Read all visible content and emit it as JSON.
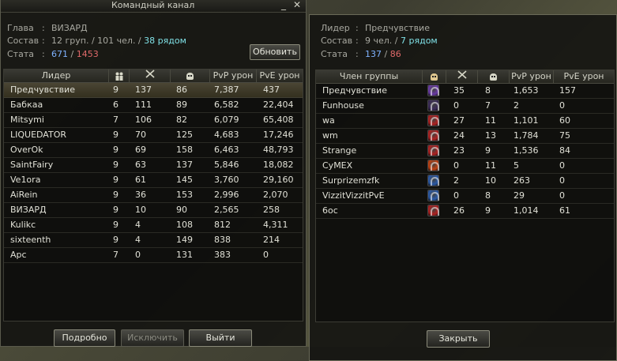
{
  "left": {
    "title": "Командный канал",
    "info": {
      "leader_label": "Глава",
      "leader_value": "ВИЗАРД",
      "composition_label": "Состав",
      "composition_groups": "12 груп. / 101 чел. /",
      "composition_nearby": "38 рядом",
      "stats_label": "Стата",
      "stats_pvp": "671",
      "stats_slash": "/",
      "stats_pve": "1453",
      "colon": ":"
    },
    "refresh_button": "Обновить",
    "columns": [
      "Лидер",
      "",
      "",
      "",
      "PvP урон",
      "PvE урон"
    ],
    "rows": [
      [
        "Предчувствие",
        "9",
        "137",
        "86",
        "7,387",
        "437"
      ],
      [
        "Бабкаа",
        "6",
        "111",
        "89",
        "6,582",
        "22,404"
      ],
      [
        "Mitsymi",
        "7",
        "106",
        "82",
        "6,079",
        "65,408"
      ],
      [
        "LIQUEDATOR",
        "9",
        "70",
        "125",
        "4,683",
        "17,246"
      ],
      [
        "OverOk",
        "9",
        "69",
        "158",
        "6,463",
        "48,793"
      ],
      [
        "SaintFairy",
        "9",
        "63",
        "137",
        "5,846",
        "18,082"
      ],
      [
        "Ve1ora",
        "9",
        "61",
        "145",
        "3,760",
        "29,160"
      ],
      [
        "AiRein",
        "9",
        "36",
        "153",
        "2,996",
        "2,070"
      ],
      [
        "ВИЗАРД",
        "9",
        "10",
        "90",
        "2,565",
        "258"
      ],
      [
        "Kulikc",
        "9",
        "4",
        "108",
        "812",
        "4,311"
      ],
      [
        "sixteenth",
        "9",
        "4",
        "149",
        "838",
        "214"
      ],
      [
        "Apc",
        "7",
        "0",
        "131",
        "383",
        "0"
      ]
    ],
    "buttons": {
      "details": "Подробно",
      "exclude": "Исключить",
      "exit": "Выйти"
    }
  },
  "right": {
    "info": {
      "leader_label": "Лидер",
      "leader_value": "Предчувствие",
      "composition_label": "Состав",
      "composition_members": "9 чел. /",
      "composition_nearby": "7 рядом",
      "stats_label": "Стата",
      "stats_pvp": "137",
      "stats_slash": "/",
      "stats_pve": "86",
      "colon": ":"
    },
    "columns": [
      "Член группы",
      "",
      "",
      "",
      "PvP урон",
      "PvE урон"
    ],
    "rows": [
      [
        "Предчувствие",
        "purple",
        "35",
        "8",
        "1,653",
        "157"
      ],
      [
        "Funhouse",
        "dark-purple",
        "0",
        "7",
        "2",
        "0"
      ],
      [
        "wa",
        "red",
        "27",
        "11",
        "1,101",
        "60"
      ],
      [
        "wm",
        "red",
        "24",
        "13",
        "1,784",
        "75"
      ],
      [
        "Strange",
        "red",
        "23",
        "9",
        "1,536",
        "84"
      ],
      [
        "CyMEX",
        "red-gold",
        "0",
        "11",
        "5",
        "0"
      ],
      [
        "Surprizemzfk",
        "blue",
        "2",
        "10",
        "263",
        "0"
      ],
      [
        "VizzitVizzitPvE",
        "blue",
        "0",
        "8",
        "29",
        "0"
      ],
      [
        "6oc",
        "red",
        "26",
        "9",
        "1,014",
        "61"
      ]
    ],
    "close_button": "Закрыть"
  },
  "colors": {
    "pvp": "#7fb3ff",
    "pve": "#e06a6a",
    "nearby": "#7fe0e6",
    "class_purple": "#6a3aa8",
    "class_dark_purple": "#3a2a58",
    "class_red": "#b02020",
    "class_red_gold": "#c04010",
    "class_blue": "#2a5aa8"
  },
  "icons": [
    "minimize-icon",
    "close-icon",
    "people-icon",
    "swords-icon",
    "skull-icon",
    "class-icon"
  ]
}
